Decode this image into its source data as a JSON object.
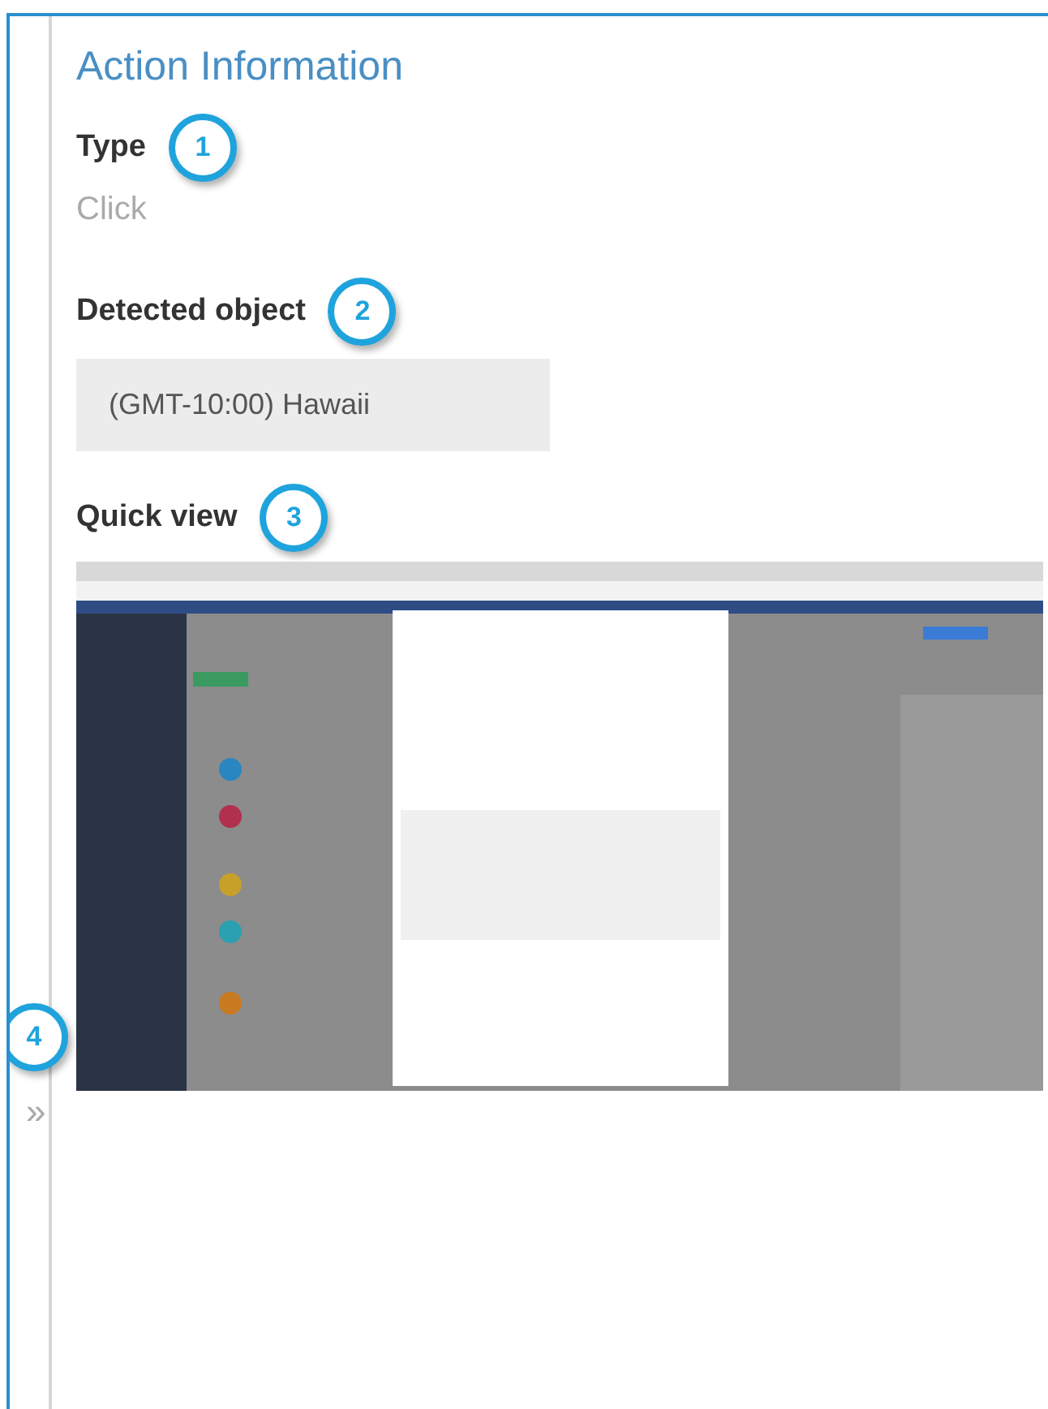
{
  "title": "Action Information",
  "fields": [
    {
      "kind": "text",
      "label": "Type",
      "badge": "1",
      "value": "Click"
    },
    {
      "kind": "box",
      "label": "Detected object",
      "badge": "2",
      "value": "(GMT-10:00) Hawaii"
    },
    {
      "kind": "picture",
      "label": "Quick view",
      "badge": "3"
    }
  ],
  "side_badge": "4",
  "expand_glyph": "»"
}
